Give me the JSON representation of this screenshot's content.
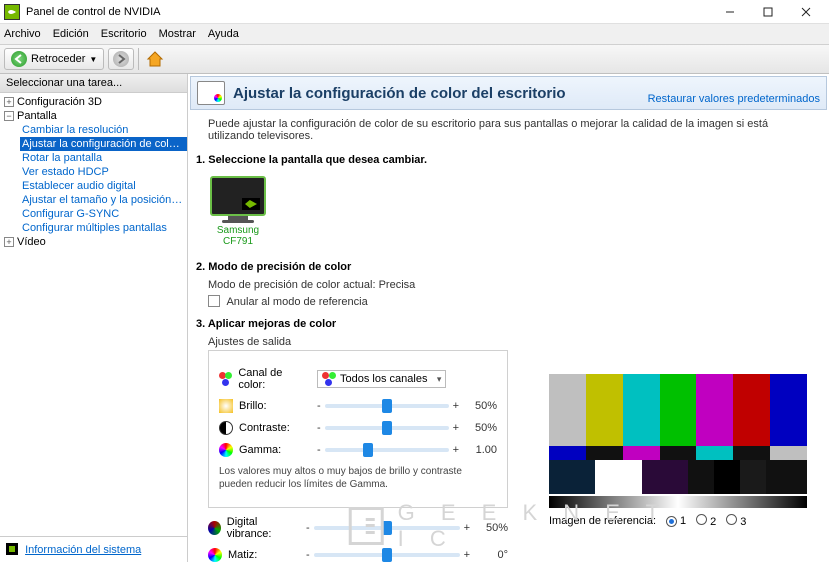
{
  "window": {
    "title": "Panel de control de NVIDIA"
  },
  "menu": {
    "file": "Archivo",
    "edit": "Edición",
    "desktop": "Escritorio",
    "show": "Mostrar",
    "help": "Ayuda"
  },
  "toolbar": {
    "back": "Retroceder"
  },
  "sidebar": {
    "header": "Seleccionar una tarea...",
    "cat_3d": "Configuración 3D",
    "cat_display": "Pantalla",
    "items": [
      "Cambiar la resolución",
      "Ajustar la configuración de color del escritorio",
      "Rotar la pantalla",
      "Ver estado HDCP",
      "Establecer audio digital",
      "Ajustar el tamaño y la posición del escritorio",
      "Configurar G-SYNC",
      "Configurar múltiples pantallas"
    ],
    "cat_video": "Vídeo",
    "sysinfo": "Información del sistema"
  },
  "page": {
    "title": "Ajustar la configuración de color del escritorio",
    "restore": "Restaurar valores predeterminados",
    "desc": "Puede ajustar la configuración de color de su escritorio para sus pantallas o mejorar la calidad de la imagen si está utilizando televisores.",
    "s1": "1. Seleccione la pantalla que desea cambiar.",
    "monitor": "Samsung CF791",
    "s2": "2. Modo de precisión de color",
    "s2_line": "Modo de precisión de color actual: Precisa",
    "s2_cb": "Anular al modo de referencia",
    "s3": "3. Aplicar mejoras de color",
    "s3_sub": "Ajustes de salida",
    "ch_label": "Canal de color:",
    "ch_value": "Todos los canales",
    "brightness_lbl": "Brillo:",
    "brightness_val": "50%",
    "contrast_lbl": "Contraste:",
    "contrast_val": "50%",
    "gamma_lbl": "Gamma:",
    "gamma_val": "1.00",
    "note": "Los valores muy altos o muy bajos de brillo y contraste pueden reducir los límites de Gamma.",
    "vibrance_lbl": "Digital vibrance:",
    "vibrance_val": "50%",
    "hue_lbl": "Matiz:",
    "hue_val": "0°",
    "ref_label": "Imagen de referencia:",
    "ref_opts": [
      "1",
      "2",
      "3"
    ]
  },
  "chart_data": {
    "type": "table",
    "title": "Ajustes de salida",
    "rows": [
      {
        "setting": "Brillo",
        "value": 50,
        "unit": "%",
        "pos": 0.5
      },
      {
        "setting": "Contraste",
        "value": 50,
        "unit": "%",
        "pos": 0.5
      },
      {
        "setting": "Gamma",
        "value": 1.0,
        "unit": "",
        "pos": 0.35
      },
      {
        "setting": "Digital vibrance",
        "value": 50,
        "unit": "%",
        "pos": 0.5
      },
      {
        "setting": "Matiz",
        "value": 0,
        "unit": "°",
        "pos": 0.5
      }
    ]
  }
}
